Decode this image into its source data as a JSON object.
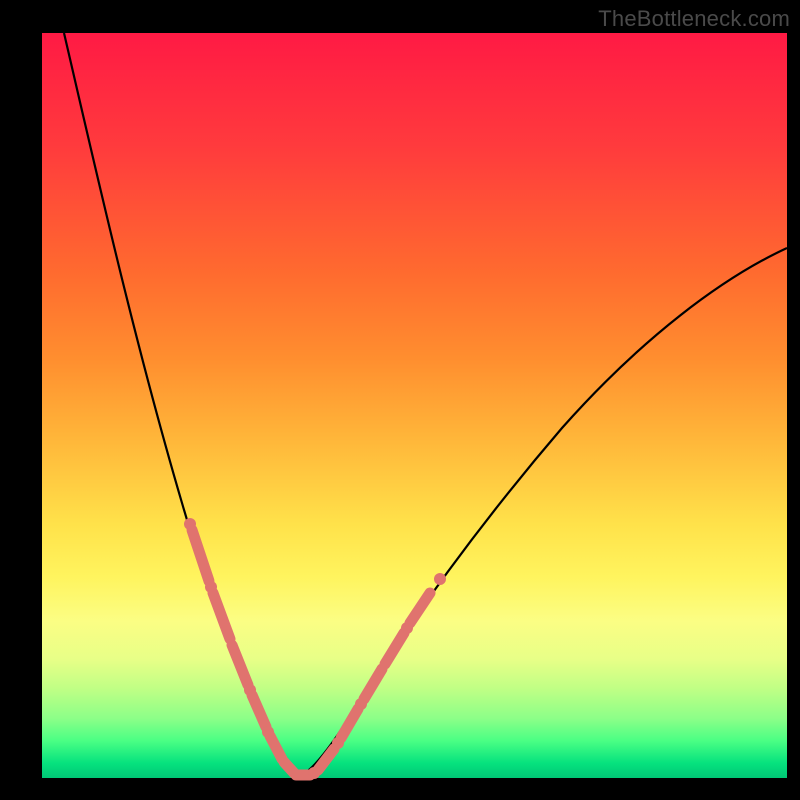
{
  "watermark_text": "TheBottleneck.com",
  "colors": {
    "background": "#000000",
    "curve": "#000000",
    "markers": "#e0736e",
    "gradient_stops": [
      "#ff1a44",
      "#ff6a2f",
      "#ffe24a",
      "#fbfe84",
      "#4aff84",
      "#00c776"
    ]
  },
  "chart_data": {
    "type": "line",
    "title": "",
    "xlabel": "",
    "ylabel": "",
    "xlim": [
      0,
      100
    ],
    "ylim": [
      0,
      100
    ],
    "description": "Two smooth curves forming a V shape meeting near x≈33, y≈0. Left curve descends steeply from top-left; right curve ascends gradually to mid-right. Color gradient top=red (high mismatch) to bottom=green (ideal). Pink segments & dots mark sampled data points concentrated near the valley floor.",
    "series": [
      {
        "name": "left-branch",
        "x": [
          3,
          6,
          9,
          12,
          15,
          18,
          21,
          24,
          27,
          30,
          33
        ],
        "values": [
          100,
          90,
          79,
          68,
          56,
          45,
          34,
          24,
          14,
          6,
          0
        ]
      },
      {
        "name": "right-branch",
        "x": [
          33,
          38,
          43,
          48,
          55,
          62,
          70,
          78,
          86,
          94,
          100
        ],
        "values": [
          0,
          6,
          12,
          18,
          26,
          33,
          41,
          49,
          56,
          63,
          67
        ]
      }
    ],
    "sampled_markers": {
      "note": "pink dots/dashes along the curves near the bottom of the V",
      "points_left": [
        [
          21,
          34
        ],
        [
          22,
          31
        ],
        [
          23,
          28
        ],
        [
          24,
          24
        ],
        [
          25,
          21
        ],
        [
          26,
          17
        ],
        [
          27,
          14
        ],
        [
          28,
          11
        ],
        [
          29,
          8
        ]
      ],
      "points_floor": [
        [
          30,
          5
        ],
        [
          31,
          3
        ],
        [
          32,
          1
        ],
        [
          33,
          0
        ],
        [
          34,
          0
        ],
        [
          35,
          1
        ],
        [
          36,
          2
        ],
        [
          37,
          3
        ]
      ],
      "points_right": [
        [
          38,
          6
        ],
        [
          39,
          7
        ],
        [
          40,
          9
        ],
        [
          41,
          10
        ],
        [
          43,
          13
        ],
        [
          45,
          16
        ],
        [
          47,
          19
        ],
        [
          49,
          22
        ],
        [
          51,
          25
        ]
      ]
    }
  }
}
